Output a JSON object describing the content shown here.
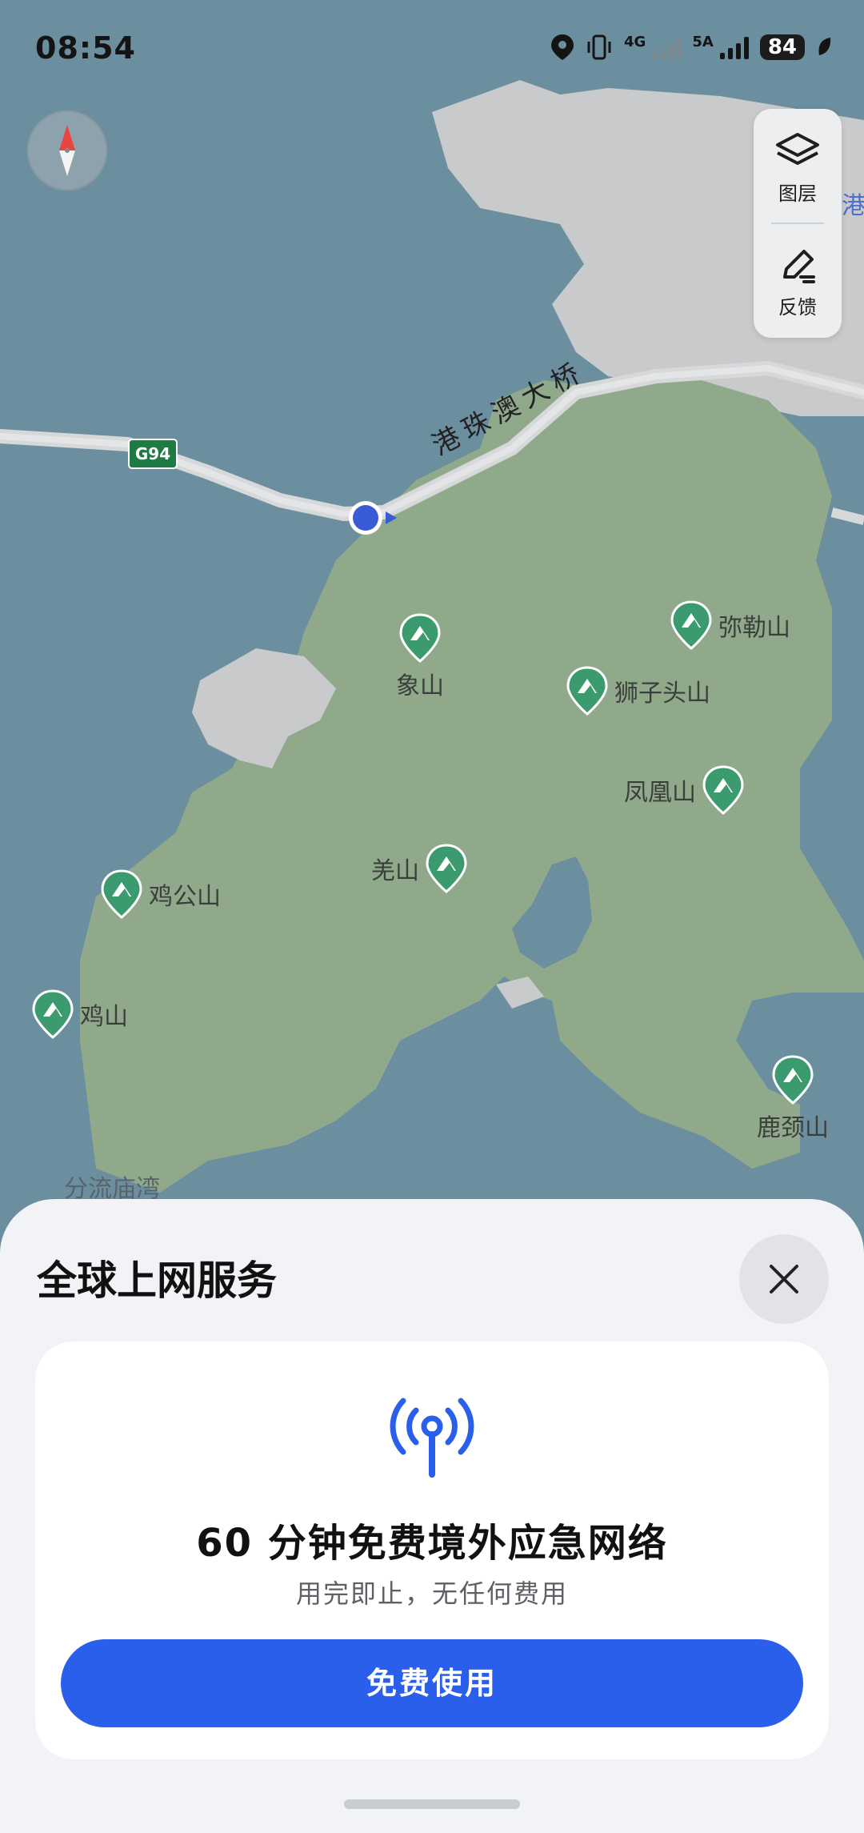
{
  "status_bar": {
    "time": "08:54",
    "network_1": "4G",
    "network_2": "5A",
    "battery": "84"
  },
  "map_controls": {
    "layers_label": "图层",
    "feedback_label": "反馈"
  },
  "map": {
    "road_shield": "G94",
    "bridge_name": "港珠澳大桥",
    "edge_label": "港",
    "bay_label": "分流庙湾",
    "peaks": [
      "弥勒山",
      "象山",
      "狮子头山",
      "凤凰山",
      "羌山",
      "鸡公山",
      "鸡山",
      "鹿颈山"
    ]
  },
  "sheet": {
    "title": "全球上网服务",
    "card_title": "60 分钟免费境外应急网络",
    "card_subtitle": "用完即止，无任何费用",
    "button_label": "免费使用"
  },
  "colors": {
    "water": "#6c8fa0",
    "land": "#8fa98a",
    "urban": "#c8cacc",
    "road": "#d6d8da",
    "poi": "#3b9b6e",
    "accent": "#2a5fec"
  },
  "icons": [
    "compass-icon",
    "layers-icon",
    "feedback-pen-icon",
    "location-dot-icon",
    "mountain-icon",
    "close-icon",
    "antenna-signal-icon"
  ]
}
